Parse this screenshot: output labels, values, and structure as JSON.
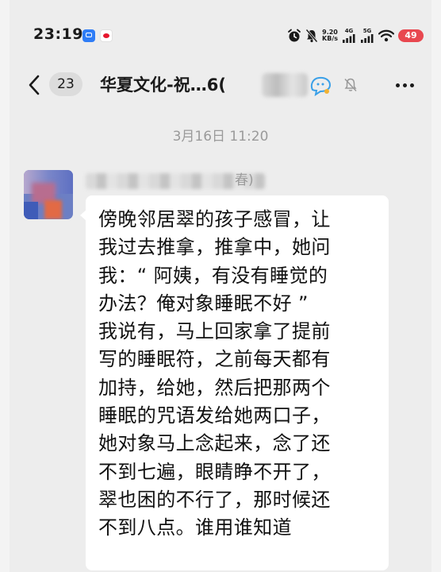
{
  "status_bar": {
    "time": "23:19",
    "net_speed_value": "9.20",
    "net_speed_unit": "KB/s",
    "signal1_label": "4G",
    "signal2_label": "5G",
    "battery": "49"
  },
  "header": {
    "unread_count": "23",
    "title": "华夏文化-祝…6("
  },
  "chat": {
    "timestamp": "3月16日 11:20",
    "message": {
      "sender_visible": "春)",
      "text": "傍晚邻居翠的孩子感冒，让\n我过去推拿，推拿中，她问\n我：“ 阿姨，有没有睡觉的\n办法？俺对象睡眠不好 ”\n我说有，马上回家拿了提前\n写的睡眠符，之前每天都有\n加持，给她，然后把那两个\n睡眠的咒语发给她两口子，\n她对象马上念起来，念了还\n不到七遍，眼睛睁不开了，\n翠也困的不行了，那时候还\n不到八点。谁用谁知道"
    }
  },
  "colors": {
    "background": "#ededed",
    "bubble": "#ffffff",
    "battery": "#e8474f",
    "timestamp_text": "#9a9a9a"
  },
  "icons": [
    "back-arrow-icon",
    "mute-bell-icon",
    "more-dots-icon",
    "alarm-icon",
    "do-not-disturb-icon",
    "wifi-icon",
    "signal-icon"
  ]
}
